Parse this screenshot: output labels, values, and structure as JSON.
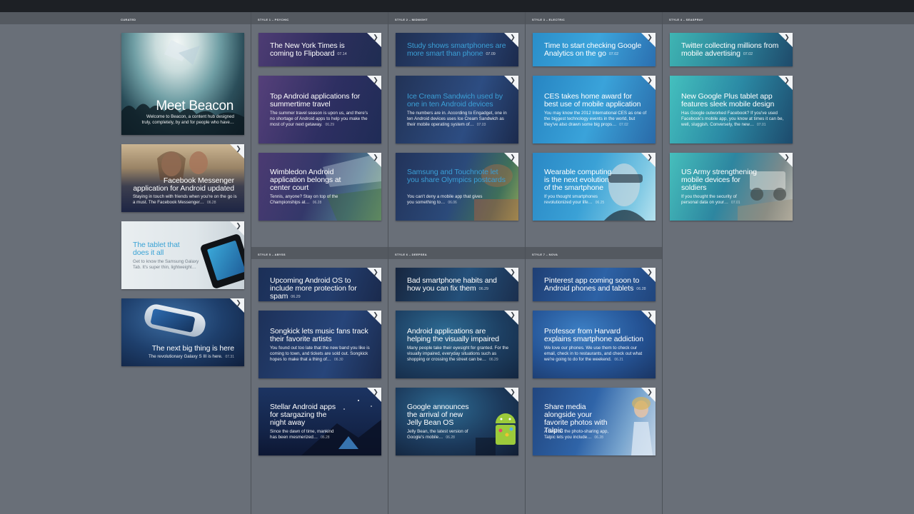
{
  "columns": {
    "curated": "CURATED",
    "psychic": "STYLE 1 – PSYCHIC",
    "midnight": "STYLE 2 – MIDNIGHT",
    "electric": "STYLE 3 – ELECTRIC",
    "seaspray": "STYLE 4 – SEASPRAY",
    "abyss": "STYLE 5 – ABYSS",
    "deepsea": "STYLE 6 – DEEPSEA",
    "nova": "STYLE 7 – NOVA"
  },
  "fold_glyph": "❯",
  "curated": [
    {
      "title": "Meet Beacon",
      "desc": "Welcome to Beacon, a content hub designed truly, completely, by and for people who have…"
    },
    {
      "title": "Facebook Messenger application for Android updated",
      "desc": "Staying in touch with friends when you're on the go is a must. The Facebook Messenger…",
      "date": "06.28"
    },
    {
      "title": "The tablet that does it all",
      "desc": "Get to know the Samsung Galaxy Tab. It's super thin, lightweight…"
    },
    {
      "title": "The next big thing is here",
      "desc": "The revolutionary Galaxy S III is here.",
      "date": "07.31"
    }
  ],
  "psychic": [
    {
      "title": "The New York Times is coming to Flipboard",
      "date": "07.14"
    },
    {
      "title": "Top Android applications for summertime travel",
      "desc": "The summer travel season is upon us, and there's no shortage of Android apps to help you make the most of your next getaway.",
      "date": "06.29"
    },
    {
      "title": "Wimbledon Android application belongs at center court",
      "desc": "Tennis, anyone? Stay on top of the Championships at…",
      "date": "06.28"
    }
  ],
  "midnight": [
    {
      "title": "Study shows smartphones are more smart than phone",
      "date": "07.09"
    },
    {
      "title": "Ice Cream Sandwich used by one in ten Android devices",
      "desc": "The numbers are in. According to Engadget, one in ten Android devices uses Ice Cream Sandwich as their mobile operating system of…",
      "date": "07.03"
    },
    {
      "title": "Samsung and Touchnote let you share Olympics postcards",
      "desc": "You can't deny a mobile app that gives you something to…",
      "date": "06.06"
    }
  ],
  "electric": [
    {
      "title": "Time to start checking Google Analytics on the go",
      "date": "07.02"
    },
    {
      "title": "CES takes home award for best use of mobile application",
      "desc": "You may know the 2012 International CES as one of the biggest technology events in the world, but they've also drawn some big props…",
      "date": "07.02"
    },
    {
      "title": "Wearable computing is the next evolution of the smartphone",
      "desc": "If you thought smartphones revolutionized your life…",
      "date": "06.25"
    }
  ],
  "seaspray": [
    {
      "title": "Twitter collecting millions from mobile advertising",
      "date": "07.02"
    },
    {
      "title": "New Google Plus tablet app features sleek mobile design",
      "desc": "Has Google outworked Facebook? If you've used Facebook's mobile app, you know at times it can be, well, sluggish. Conversely, the new…",
      "date": "07.01"
    },
    {
      "title": "US Army strengthening mobile devices for soldiers",
      "desc": "If you thought the security of personal data on your…",
      "date": "07.01"
    }
  ],
  "abyss": [
    {
      "title": "Upcoming Android OS to include more protection for spam",
      "date": "06.29"
    },
    {
      "title": "Songkick lets music fans track their favorite artists",
      "desc": "You found out too late that the new band you like is coming to town, and tickets are sold out. Songkick hopes to make that a thing of…",
      "date": "06.30"
    },
    {
      "title": "Stellar Android apps for stargazing the night away",
      "desc": "Since the dawn of time, mankind has been mesmerized…",
      "date": "06.28"
    }
  ],
  "deepsea": [
    {
      "title": "Bad smartphone habits and how you can fix them",
      "date": "06.29"
    },
    {
      "title": "Android applications are helping the visually impaired",
      "desc": "Many people take their eyesight for granted. For the visually impaired, everyday situations such as shopping or crossing the street can be…",
      "date": "06.29"
    },
    {
      "title": "Google announces the arrival of new Jelly Bean OS",
      "desc": "Jelly Bean, the latest version of Google's mobile…",
      "date": "06.28"
    }
  ],
  "nova": [
    {
      "title": "Pinterest app coming soon to Android phones and tablets",
      "date": "06.28"
    },
    {
      "title": "Professor from Harvard explains smartphone addiction",
      "desc": "We love our phones. We use them to check our email, check in to restaurants, and check out what we're going to do for the weekend.",
      "date": "06.21"
    },
    {
      "title": "Share media alongside your favorite photos with Talpic",
      "desc": "A twist on the photo-sharing app, Talpic lets you include…",
      "date": "06.28"
    }
  ]
}
